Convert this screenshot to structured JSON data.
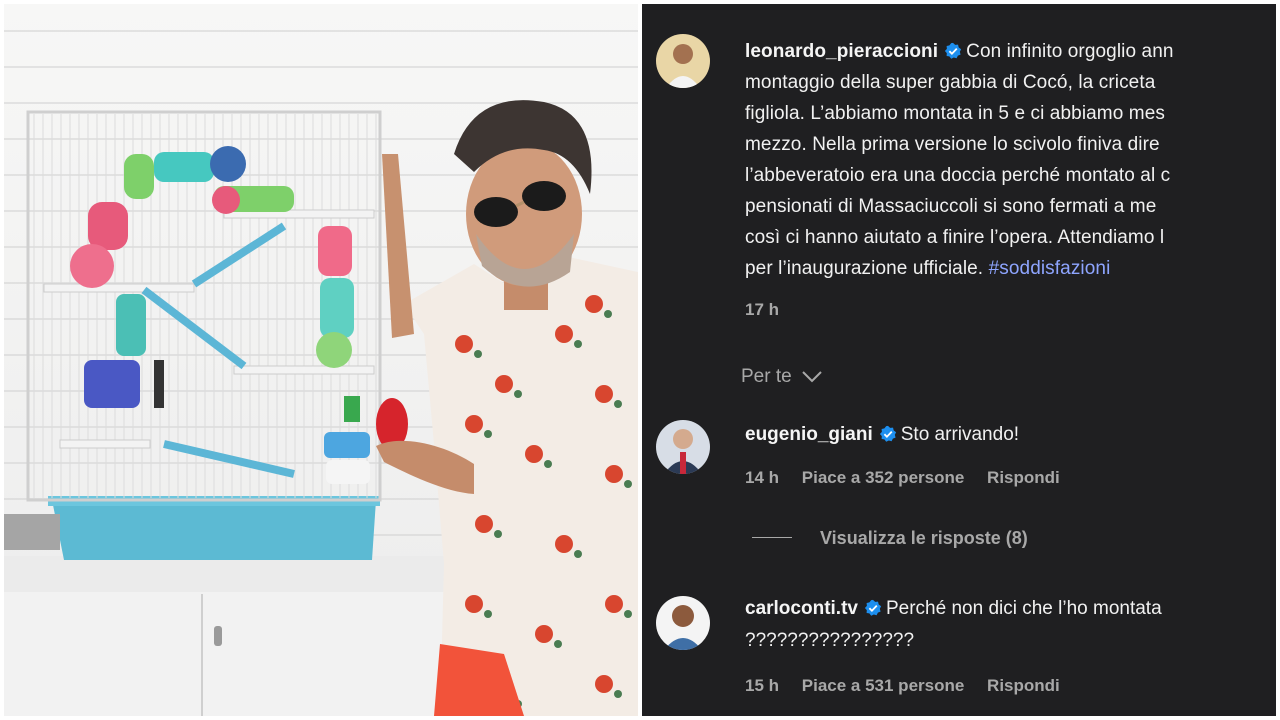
{
  "post": {
    "username": "leonardo_pieraccioni",
    "lines": [
      "Con infinito orgoglio ann",
      "montaggio della super gabbia di Cocó, la criceta",
      "figliola. L’abbiamo montata in 5 e ci abbiamo mes",
      "mezzo. Nella prima versione lo scivolo finiva dire",
      "l’abbeveratoio era una doccia perché montato al c",
      "pensionati di Massaciuccoli si sono fermati a me",
      "così ci hanno aiutato a finire l’opera. Attendiamo l",
      "per l’inaugurazione ufficiale."
    ],
    "hashtag": "#soddisfazioni",
    "time": "17 h",
    "translate_label": "Per te",
    "translate_chevron": "chevron-down-icon"
  },
  "comments": [
    {
      "username": "eugenio_giani",
      "text": "Sto arrivando!",
      "time": "14 h",
      "likes": "Piace a 352 persone",
      "reply": "Rispondi"
    },
    {
      "username": "carloconti.tv",
      "text": "Perché non dici che l’ho montata",
      "text2": "????????????????",
      "time": "15 h",
      "likes": "Piace a 531 persone",
      "reply": "Rispondi"
    }
  ],
  "view_replies": "Visualizza le risposte (8)",
  "colors": {
    "panel_bg": "#1f1f21",
    "verified": "#1d8fef",
    "hashtag": "#8ea5ff",
    "muted": "#a8a8a8"
  }
}
